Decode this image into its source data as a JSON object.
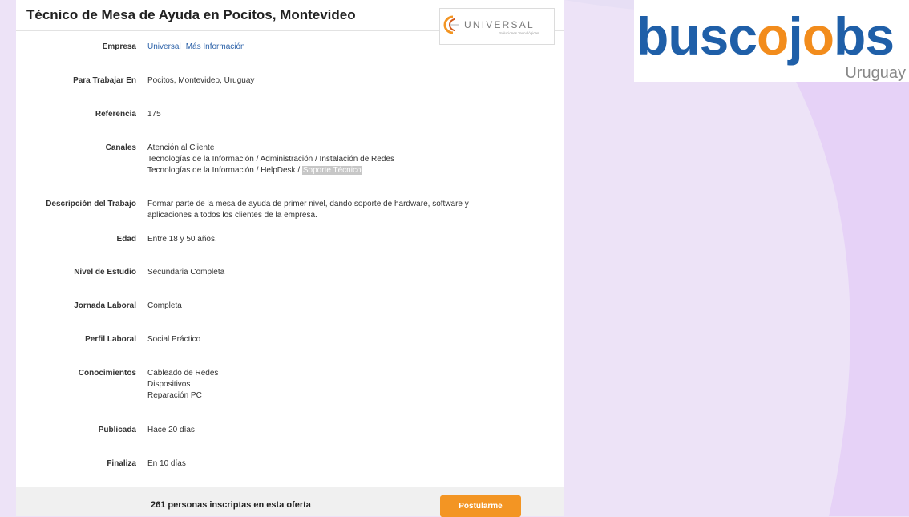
{
  "job": {
    "title": "Técnico de Mesa de Ayuda en Pocitos, Montevideo",
    "company_logo": {
      "name": "UNIVERSAL",
      "tagline": "Soluciones Tecnológicas"
    },
    "fields": {
      "empresa": {
        "label": "Empresa",
        "company_link": "Universal",
        "more_info_link": "Más Información"
      },
      "ubicacion": {
        "label": "Para Trabajar En",
        "value": "Pocitos, Montevideo, Uruguay"
      },
      "referencia": {
        "label": "Referencia",
        "value": "175"
      },
      "canales": {
        "label": "Canales",
        "lines": [
          "Atención al Cliente",
          "Tecnologías de la Información / Administración / Instalación de Redes"
        ],
        "last_line_prefix": "Tecnologías de la Información / HelpDesk / ",
        "last_line_highlight": "Soporte Técnico"
      },
      "descripcion": {
        "label": "Descripción del Trabajo",
        "value": "Formar parte de la mesa de ayuda de primer nivel, dando soporte de hardware, software y aplicaciones a todos los clientes de la empresa."
      },
      "edad": {
        "label": "Edad",
        "value": "Entre 18 y 50 años."
      },
      "nivel_estudio": {
        "label": "Nivel de Estudio",
        "value": "Secundaria Completa"
      },
      "jornada": {
        "label": "Jornada Laboral",
        "value": "Completa"
      },
      "perfil": {
        "label": "Perfil Laboral",
        "value": "Social Práctico"
      },
      "conocimientos": {
        "label": "Conocimientos",
        "items": [
          "Cableado de Redes",
          "Dispositivos",
          "Reparación PC"
        ]
      },
      "publicada": {
        "label": "Publicada",
        "value": "Hace 20 días"
      },
      "finaliza": {
        "label": "Finaliza",
        "value": "En 10 días"
      }
    },
    "footer": {
      "applicants_text": "261 personas inscriptas en esta oferta",
      "apply_label": "Postularme"
    }
  },
  "brand": {
    "parts": [
      "busc",
      "o",
      "j",
      "o",
      "bs"
    ],
    "country": "Uruguay"
  },
  "colors": {
    "link": "#2b61a8",
    "apply_button": "#f39523",
    "brand_blue": "#1f5fa8",
    "brand_orange": "#f28c1c",
    "background_lavender": "#ede3f7",
    "highlight": "#c7c7c7"
  }
}
